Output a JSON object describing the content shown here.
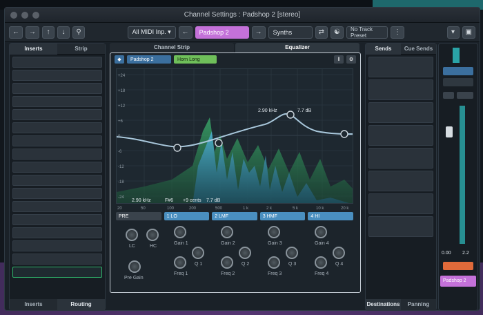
{
  "window": {
    "title": "Channel Settings : Padshop 2 [stereo]"
  },
  "toolbar": {
    "input_routing": "All MIDI Inp. ▾",
    "channel_name": "Padshop 2",
    "folder": "Synths",
    "preset": "No Track Preset"
  },
  "inserts": {
    "tab_inserts": "Inserts",
    "tab_strip": "Strip",
    "bottom_inserts": "Inserts",
    "bottom_routing": "Routing"
  },
  "center_tabs": {
    "channel_strip": "Channel Strip",
    "equalizer": "Equalizer"
  },
  "eq": {
    "channel_chip": "Padshop 2",
    "preset_chip": "Horn Long",
    "readout_freq": "2.90 kHz",
    "readout_gain": "7.7 dB",
    "footer_freq": "2.90 kHz",
    "footer_note": "F#6",
    "footer_cents": "+9 cents",
    "footer_gain": "7.7 dB",
    "y_ticks": [
      "+24",
      "+18",
      "+12",
      "+6",
      "0",
      "-6",
      "-12",
      "-18",
      "-24"
    ],
    "x_ticks": [
      "20",
      "50",
      "100",
      "200",
      "500",
      "1 k",
      "2 k",
      "5 k",
      "10 k",
      "20 k"
    ],
    "bands": {
      "pre": "PRE",
      "b1": "1 LO",
      "b2": "2 LMF",
      "b3": "3 HMF",
      "b4": "4 HI"
    },
    "knobs": {
      "lc": "LC",
      "hc": "HC",
      "pre_gain": "Pre Gain",
      "gain1": "Gain 1",
      "freq1": "Freq 1",
      "q1": "Q 1",
      "gain2": "Gain 2",
      "freq2": "Freq 2",
      "q2": "Q 2",
      "gain3": "Gain 3",
      "freq3": "Freq 3",
      "q3": "Q 3",
      "gain4": "Gain 4",
      "freq4": "Freq 4",
      "q4": "Q 4"
    }
  },
  "sends": {
    "tab_sends": "Sends",
    "tab_cue": "Cue Sends",
    "bottom_destinations": "Destinations",
    "bottom_panning": "Panning"
  },
  "meter": {
    "value_left": "0.00",
    "value_right": "2.2",
    "channel_label": "Padshop 2"
  },
  "colors": {
    "accent_purple": "#c471d9",
    "eq_blue": "#4a8fc0",
    "preset_green": "#6fbf5a",
    "teal": "#2aa3a6"
  },
  "icons": [
    "back-icon",
    "forward-icon",
    "up-icon",
    "down-icon",
    "search-icon",
    "arrow-left-icon",
    "arrow-right-icon",
    "settings-icon"
  ]
}
